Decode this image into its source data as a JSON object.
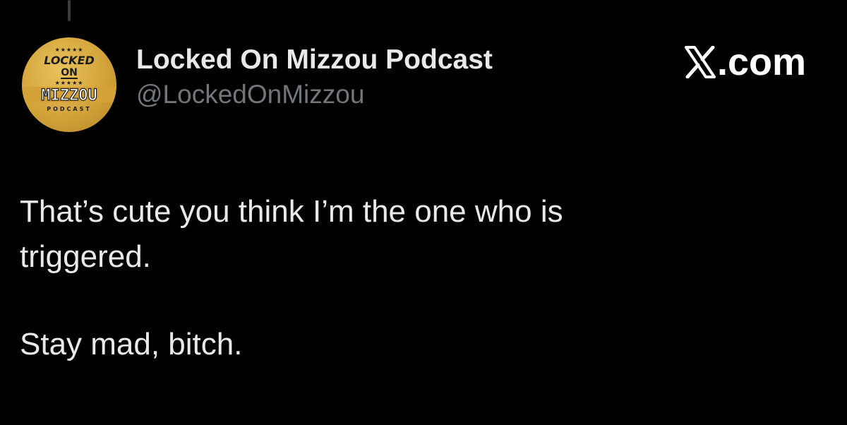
{
  "author": {
    "display_name": "Locked On Mizzou Podcast",
    "handle": "@LockedOnMizzou",
    "avatar": {
      "icon": "locked-on-mizzou-logo",
      "lines": [
        "LOCKED",
        "ON",
        "MIZZOU",
        "PODCAST"
      ]
    }
  },
  "brand": {
    "label": ".com",
    "icon": "x-logo-icon"
  },
  "tweet": {
    "paragraphs": [
      [
        "That’s cute you think I’m the one who is",
        "triggered."
      ],
      [
        "Stay mad, bitch."
      ]
    ]
  },
  "colors": {
    "background": "#000000",
    "text_primary": "#e7e9ea",
    "text_secondary": "#71767b",
    "avatar_gold": "#d3a33a"
  }
}
